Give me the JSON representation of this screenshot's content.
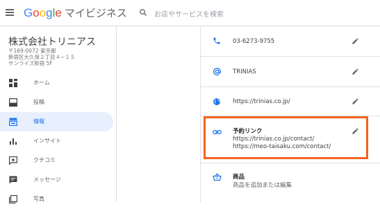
{
  "header": {
    "logo_parts": [
      "G",
      "o",
      "o",
      "g",
      "l",
      "e"
    ],
    "logo_suffix": "マイビジネス",
    "search_placeholder": "お店やサービスを検索"
  },
  "business": {
    "name": "株式会社トリニアス",
    "address_lines": [
      "〒169-0072 東京都",
      "新宿区大久保２丁目４−１５",
      "サンライズ新宿 5F"
    ]
  },
  "sidebar": {
    "items": [
      {
        "label": "ホーム",
        "icon": "home-grid-icon",
        "active": false
      },
      {
        "label": "投稿",
        "icon": "post-icon",
        "active": false
      },
      {
        "label": "情報",
        "icon": "info-store-icon",
        "active": true
      },
      {
        "label": "インサイト",
        "icon": "insights-icon",
        "active": false
      },
      {
        "label": "クチコミ",
        "icon": "reviews-icon",
        "active": false
      },
      {
        "label": "メッセージ",
        "icon": "messages-icon",
        "active": false
      },
      {
        "label": "写真",
        "icon": "photos-icon",
        "active": false
      }
    ]
  },
  "info": {
    "phone": "03-6273-9755",
    "handle": "TRINIAS",
    "website": "https://trinias.co.jp/",
    "booking_title": "予約リンク",
    "booking_links": [
      "https://trinias.co.jp/contact/",
      "https://meo-taisaku.com/contact/"
    ],
    "products_title": "商品",
    "products_sub": "商品を追加または編集"
  },
  "colors": {
    "accent": "#1a73e8",
    "highlight": "#f5621e",
    "active_bg": "#e8f0fe"
  }
}
